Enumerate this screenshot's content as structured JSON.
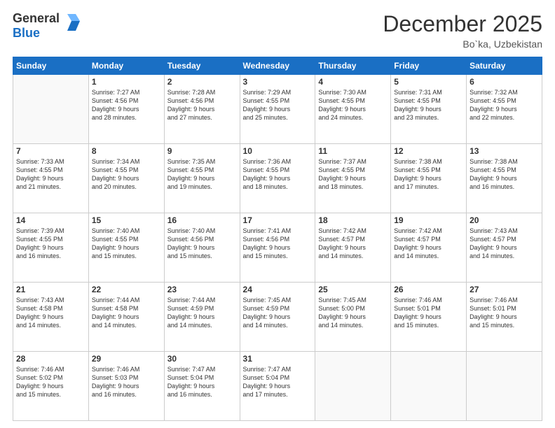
{
  "logo": {
    "line1": "General",
    "line2": "Blue"
  },
  "title": "December 2025",
  "location": "Bo`ka, Uzbekistan",
  "weekdays": [
    "Sunday",
    "Monday",
    "Tuesday",
    "Wednesday",
    "Thursday",
    "Friday",
    "Saturday"
  ],
  "weeks": [
    [
      {
        "day": "",
        "info": ""
      },
      {
        "day": "1",
        "info": "Sunrise: 7:27 AM\nSunset: 4:56 PM\nDaylight: 9 hours\nand 28 minutes."
      },
      {
        "day": "2",
        "info": "Sunrise: 7:28 AM\nSunset: 4:56 PM\nDaylight: 9 hours\nand 27 minutes."
      },
      {
        "day": "3",
        "info": "Sunrise: 7:29 AM\nSunset: 4:55 PM\nDaylight: 9 hours\nand 25 minutes."
      },
      {
        "day": "4",
        "info": "Sunrise: 7:30 AM\nSunset: 4:55 PM\nDaylight: 9 hours\nand 24 minutes."
      },
      {
        "day": "5",
        "info": "Sunrise: 7:31 AM\nSunset: 4:55 PM\nDaylight: 9 hours\nand 23 minutes."
      },
      {
        "day": "6",
        "info": "Sunrise: 7:32 AM\nSunset: 4:55 PM\nDaylight: 9 hours\nand 22 minutes."
      }
    ],
    [
      {
        "day": "7",
        "info": "Sunrise: 7:33 AM\nSunset: 4:55 PM\nDaylight: 9 hours\nand 21 minutes."
      },
      {
        "day": "8",
        "info": "Sunrise: 7:34 AM\nSunset: 4:55 PM\nDaylight: 9 hours\nand 20 minutes."
      },
      {
        "day": "9",
        "info": "Sunrise: 7:35 AM\nSunset: 4:55 PM\nDaylight: 9 hours\nand 19 minutes."
      },
      {
        "day": "10",
        "info": "Sunrise: 7:36 AM\nSunset: 4:55 PM\nDaylight: 9 hours\nand 18 minutes."
      },
      {
        "day": "11",
        "info": "Sunrise: 7:37 AM\nSunset: 4:55 PM\nDaylight: 9 hours\nand 18 minutes."
      },
      {
        "day": "12",
        "info": "Sunrise: 7:38 AM\nSunset: 4:55 PM\nDaylight: 9 hours\nand 17 minutes."
      },
      {
        "day": "13",
        "info": "Sunrise: 7:38 AM\nSunset: 4:55 PM\nDaylight: 9 hours\nand 16 minutes."
      }
    ],
    [
      {
        "day": "14",
        "info": "Sunrise: 7:39 AM\nSunset: 4:55 PM\nDaylight: 9 hours\nand 16 minutes."
      },
      {
        "day": "15",
        "info": "Sunrise: 7:40 AM\nSunset: 4:55 PM\nDaylight: 9 hours\nand 15 minutes."
      },
      {
        "day": "16",
        "info": "Sunrise: 7:40 AM\nSunset: 4:56 PM\nDaylight: 9 hours\nand 15 minutes."
      },
      {
        "day": "17",
        "info": "Sunrise: 7:41 AM\nSunset: 4:56 PM\nDaylight: 9 hours\nand 15 minutes."
      },
      {
        "day": "18",
        "info": "Sunrise: 7:42 AM\nSunset: 4:57 PM\nDaylight: 9 hours\nand 14 minutes."
      },
      {
        "day": "19",
        "info": "Sunrise: 7:42 AM\nSunset: 4:57 PM\nDaylight: 9 hours\nand 14 minutes."
      },
      {
        "day": "20",
        "info": "Sunrise: 7:43 AM\nSunset: 4:57 PM\nDaylight: 9 hours\nand 14 minutes."
      }
    ],
    [
      {
        "day": "21",
        "info": "Sunrise: 7:43 AM\nSunset: 4:58 PM\nDaylight: 9 hours\nand 14 minutes."
      },
      {
        "day": "22",
        "info": "Sunrise: 7:44 AM\nSunset: 4:58 PM\nDaylight: 9 hours\nand 14 minutes."
      },
      {
        "day": "23",
        "info": "Sunrise: 7:44 AM\nSunset: 4:59 PM\nDaylight: 9 hours\nand 14 minutes."
      },
      {
        "day": "24",
        "info": "Sunrise: 7:45 AM\nSunset: 4:59 PM\nDaylight: 9 hours\nand 14 minutes."
      },
      {
        "day": "25",
        "info": "Sunrise: 7:45 AM\nSunset: 5:00 PM\nDaylight: 9 hours\nand 14 minutes."
      },
      {
        "day": "26",
        "info": "Sunrise: 7:46 AM\nSunset: 5:01 PM\nDaylight: 9 hours\nand 15 minutes."
      },
      {
        "day": "27",
        "info": "Sunrise: 7:46 AM\nSunset: 5:01 PM\nDaylight: 9 hours\nand 15 minutes."
      }
    ],
    [
      {
        "day": "28",
        "info": "Sunrise: 7:46 AM\nSunset: 5:02 PM\nDaylight: 9 hours\nand 15 minutes."
      },
      {
        "day": "29",
        "info": "Sunrise: 7:46 AM\nSunset: 5:03 PM\nDaylight: 9 hours\nand 16 minutes."
      },
      {
        "day": "30",
        "info": "Sunrise: 7:47 AM\nSunset: 5:04 PM\nDaylight: 9 hours\nand 16 minutes."
      },
      {
        "day": "31",
        "info": "Sunrise: 7:47 AM\nSunset: 5:04 PM\nDaylight: 9 hours\nand 17 minutes."
      },
      {
        "day": "",
        "info": ""
      },
      {
        "day": "",
        "info": ""
      },
      {
        "day": "",
        "info": ""
      }
    ]
  ]
}
